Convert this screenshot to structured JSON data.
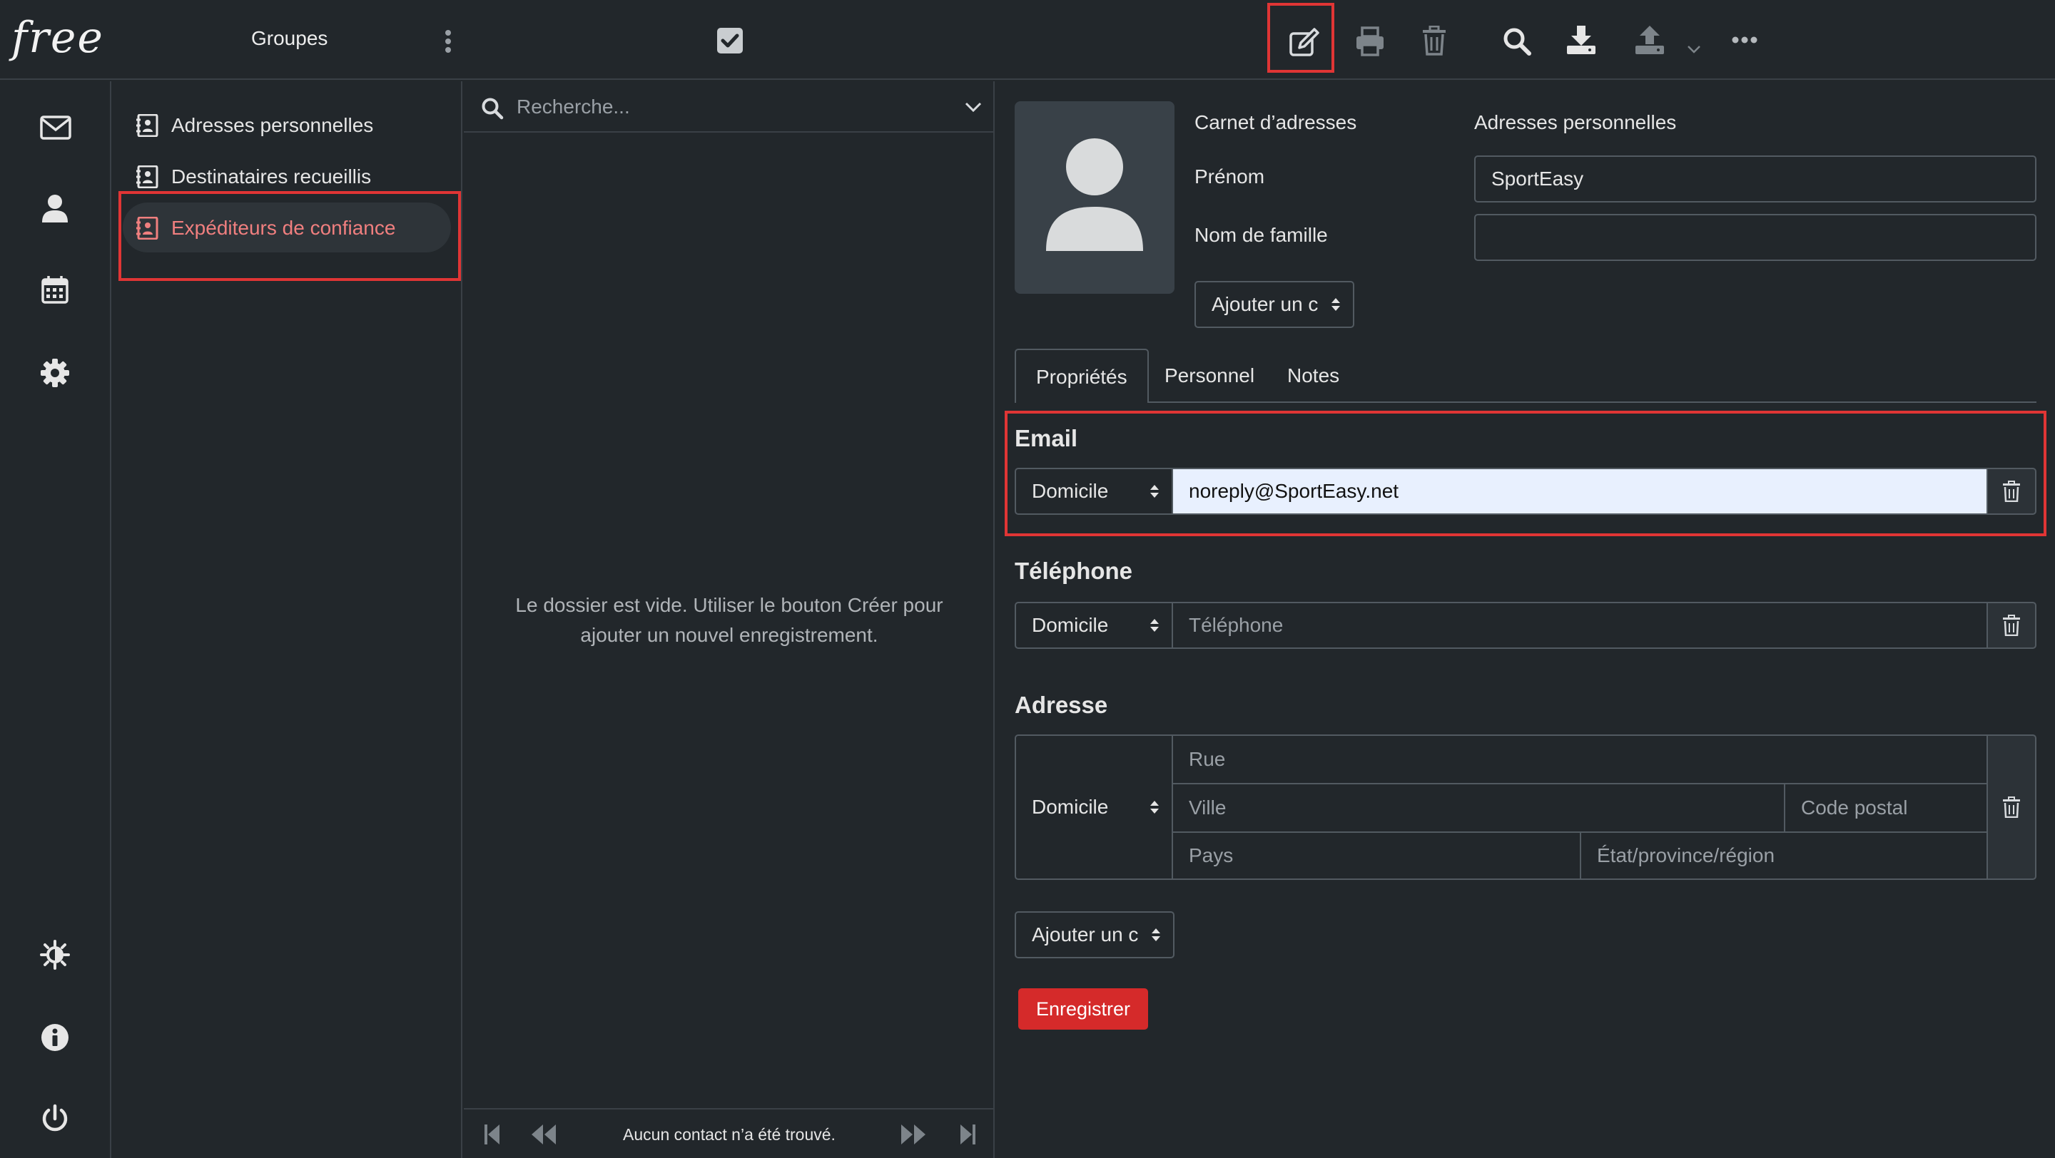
{
  "app": {
    "logo_text": "free"
  },
  "header": {
    "groups_label": "Groupes",
    "toolbar": [
      "select-all",
      "edit",
      "print",
      "delete",
      "search",
      "import",
      "export",
      "more"
    ]
  },
  "rail": {
    "icons": [
      "mail-icon",
      "contacts-icon",
      "calendar-icon",
      "settings-icon",
      "theme-icon",
      "info-icon",
      "logout-icon"
    ]
  },
  "folders": {
    "items": [
      {
        "label": "Adresses personnelles"
      },
      {
        "label": "Destinataires recueillis"
      },
      {
        "label": "Expéditeurs de confiance"
      }
    ]
  },
  "list": {
    "search_placeholder": "Recherche...",
    "empty_message": "Le dossier est vide. Utiliser le bouton Créer pour ajouter un nouvel enregistrement.",
    "footer_message": "Aucun contact n’a été trouvé."
  },
  "contact": {
    "addressbook_label": "Carnet d’adresses",
    "addressbook_value": "Adresses personnelles",
    "firstname_label": "Prénom",
    "firstname_value": "SportEasy",
    "lastname_label": "Nom de famille",
    "lastname_value": "",
    "add_field_label": "Ajouter un c",
    "tabs": [
      {
        "label": "Propriétés"
      },
      {
        "label": "Personnel"
      },
      {
        "label": "Notes"
      }
    ],
    "email": {
      "title": "Email",
      "type": "Domicile",
      "value": "noreply@SportEasy.net"
    },
    "phone": {
      "title": "Téléphone",
      "type": "Domicile",
      "placeholder": "Téléphone"
    },
    "address": {
      "title": "Adresse",
      "type": "Domicile",
      "street_placeholder": "Rue",
      "city_placeholder": "Ville",
      "zip_placeholder": "Code postal",
      "country_placeholder": "Pays",
      "region_placeholder": "État/province/région"
    },
    "add_field_label_2": "Ajouter un c",
    "save_label": "Enregistrer"
  },
  "colors": {
    "background": "#22272b",
    "accent_red": "#e03535",
    "save_button": "#d52a2a",
    "email_field": "#e8f0fe"
  }
}
